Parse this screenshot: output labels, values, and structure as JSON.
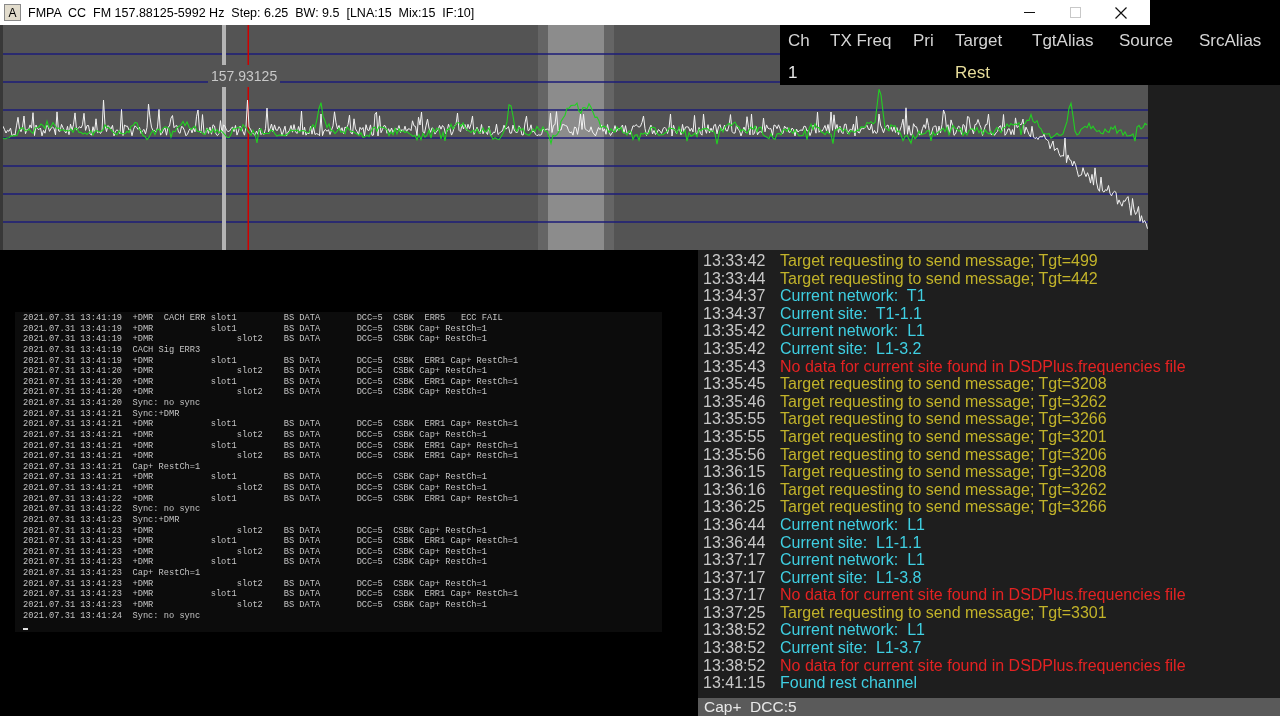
{
  "window": {
    "app_icon": "A",
    "title": "FMPA  CC  FM 157.88125-5992 Hz  Step: 6.25  BW: 9.5  [LNA:15  Mix:15  IF:10]",
    "caption_buttons": [
      {
        "kind": "minimize",
        "disabled": false
      },
      {
        "kind": "maximize",
        "disabled": true
      },
      {
        "kind": "close",
        "disabled": false
      }
    ]
  },
  "spectrum": {
    "marker_label": "157.93125"
  },
  "channel_table": {
    "columns": [
      "Ch",
      "TX Freq",
      "Pri",
      "Target",
      "TgtAlias",
      "Source",
      "SrcAlias"
    ],
    "rows": [
      {
        "ch": "1",
        "target": "Rest"
      }
    ]
  },
  "console": {
    "lines": [
      "2021.07.31 13:41:19  +DMR  CACH ERR slot1         BS DATA       DCC=5  CSBK  ERR5   ECC FAIL",
      "2021.07.31 13:41:19  +DMR           slot1         BS DATA       DCC=5  CSBK Cap+ RestCh=1",
      "2021.07.31 13:41:19  +DMR                slot2    BS DATA       DCC=5  CSBK Cap+ RestCh=1",
      "2021.07.31 13:41:19  CACH Sig ERR3",
      "2021.07.31 13:41:19  +DMR           slot1         BS DATA       DCC=5  CSBK  ERR1 Cap+ RestCh=1",
      "2021.07.31 13:41:20  +DMR                slot2    BS DATA       DCC=5  CSBK Cap+ RestCh=1",
      "2021.07.31 13:41:20  +DMR           slot1         BS DATA       DCC=5  CSBK  ERR1 Cap+ RestCh=1",
      "2021.07.31 13:41:20  +DMR                slot2    BS DATA       DCC=5  CSBK Cap+ RestCh=1",
      "2021.07.31 13:41:20  Sync: no sync",
      "2021.07.31 13:41:21  Sync:+DMR",
      "2021.07.31 13:41:21  +DMR           slot1         BS DATA       DCC=5  CSBK  ERR1 Cap+ RestCh=1",
      "2021.07.31 13:41:21  +DMR                slot2    BS DATA       DCC=5  CSBK Cap+ RestCh=1",
      "2021.07.31 13:41:21  +DMR           slot1         BS DATA       DCC=5  CSBK  ERR1 Cap+ RestCh=1",
      "2021.07.31 13:41:21  +DMR                slot2    BS DATA       DCC=5  CSBK  ERR1 Cap+ RestCh=1",
      "2021.07.31 13:41:21  Cap+ RestCh=1",
      "2021.07.31 13:41:21  +DMR           slot1         BS DATA       DCC=5  CSBK Cap+ RestCh=1",
      "2021.07.31 13:41:21  +DMR                slot2    BS DATA       DCC=5  CSBK Cap+ RestCh=1",
      "2021.07.31 13:41:22  +DMR           slot1         BS DATA       DCC=5  CSBK  ERR1 Cap+ RestCh=1",
      "2021.07.31 13:41:22  Sync: no sync",
      "2021.07.31 13:41:23  Sync:+DMR",
      "2021.07.31 13:41:23  +DMR                slot2    BS DATA       DCC=5  CSBK Cap+ RestCh=1",
      "2021.07.31 13:41:23  +DMR           slot1         BS DATA       DCC=5  CSBK  ERR1 Cap+ RestCh=1",
      "2021.07.31 13:41:23  +DMR                slot2    BS DATA       DCC=5  CSBK Cap+ RestCh=1",
      "2021.07.31 13:41:23  +DMR           slot1         BS DATA       DCC=5  CSBK Cap+ RestCh=1",
      "2021.07.31 13:41:23  Cap+ RestCh=1",
      "2021.07.31 13:41:23  +DMR                slot2    BS DATA       DCC=5  CSBK Cap+ RestCh=1",
      "2021.07.31 13:41:23  +DMR           slot1         BS DATA       DCC=5  CSBK  ERR1 Cap+ RestCh=1",
      "2021.07.31 13:41:23  +DMR                slot2    BS DATA       DCC=5  CSBK Cap+ RestCh=1",
      "2021.07.31 13:41:24  Sync: no sync"
    ]
  },
  "event_log": {
    "entries": [
      {
        "time": "13:33:42",
        "message": "Target requesting to send message; Tgt=499",
        "kind": "request"
      },
      {
        "time": "13:33:44",
        "message": "Target requesting to send message; Tgt=442",
        "kind": "request"
      },
      {
        "time": "13:34:37",
        "message": "Current network:  T1",
        "kind": "info"
      },
      {
        "time": "13:34:37",
        "message": "Current site:  T1-1.1",
        "kind": "info"
      },
      {
        "time": "13:35:42",
        "message": "Current network:  L1",
        "kind": "info"
      },
      {
        "time": "13:35:42",
        "message": "Current site:  L1-3.2",
        "kind": "info"
      },
      {
        "time": "13:35:43",
        "message": "No data for current site found in DSDPlus.frequencies file",
        "kind": "error"
      },
      {
        "time": "13:35:45",
        "message": "Target requesting to send message; Tgt=3208",
        "kind": "request"
      },
      {
        "time": "13:35:46",
        "message": "Target requesting to send message; Tgt=3262",
        "kind": "request"
      },
      {
        "time": "13:35:55",
        "message": "Target requesting to send message; Tgt=3266",
        "kind": "request"
      },
      {
        "time": "13:35:55",
        "message": "Target requesting to send message; Tgt=3201",
        "kind": "request"
      },
      {
        "time": "13:35:56",
        "message": "Target requesting to send message; Tgt=3206",
        "kind": "request"
      },
      {
        "time": "13:36:15",
        "message": "Target requesting to send message; Tgt=3208",
        "kind": "request"
      },
      {
        "time": "13:36:16",
        "message": "Target requesting to send message; Tgt=3262",
        "kind": "request"
      },
      {
        "time": "13:36:25",
        "message": "Target requesting to send message; Tgt=3266",
        "kind": "request"
      },
      {
        "time": "13:36:44",
        "message": "Current network:  L1",
        "kind": "info"
      },
      {
        "time": "13:36:44",
        "message": "Current site:  L1-1.1",
        "kind": "info"
      },
      {
        "time": "13:37:17",
        "message": "Current network:  L1",
        "kind": "info"
      },
      {
        "time": "13:37:17",
        "message": "Current site:  L1-3.8",
        "kind": "info"
      },
      {
        "time": "13:37:17",
        "message": "No data for current site found in DSDPlus.frequencies file",
        "kind": "error"
      },
      {
        "time": "13:37:25",
        "message": "Target requesting to send message; Tgt=3301",
        "kind": "request"
      },
      {
        "time": "13:38:52",
        "message": "Current network:  L1",
        "kind": "info"
      },
      {
        "time": "13:38:52",
        "message": "Current site:  L1-3.7",
        "kind": "info"
      },
      {
        "time": "13:38:52",
        "message": "No data for current site found in DSDPlus.frequencies file",
        "kind": "error"
      },
      {
        "time": "13:41:15",
        "message": "Found rest channel",
        "kind": "info"
      }
    ]
  },
  "status_bar": {
    "text": "Cap+  DCC:5"
  }
}
